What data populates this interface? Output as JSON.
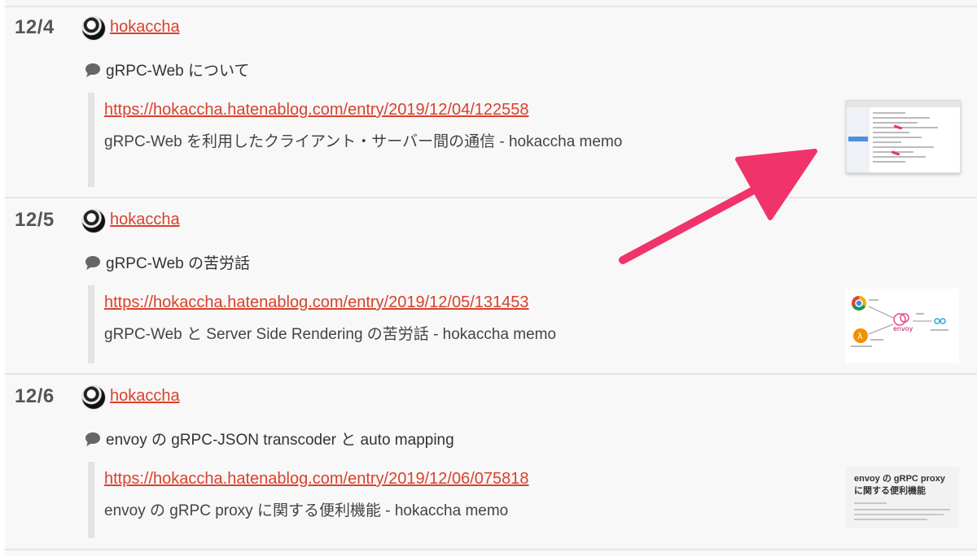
{
  "entries": [
    {
      "date": "12/4",
      "user": "hokaccha",
      "comment": "gRPC-Web について",
      "url": "https://hokaccha.hatenablog.com/entry/2019/12/04/122558",
      "title": "gRPC-Web を利用したクライアント・サーバー間の通信 - hokaccha memo"
    },
    {
      "date": "12/5",
      "user": "hokaccha",
      "comment": "gRPC-Web の苦労話",
      "url": "https://hokaccha.hatenablog.com/entry/2019/12/05/131453",
      "title": "gRPC-Web と Server Side Rendering の苦労話 - hokaccha memo",
      "thumb_labels": [
        "envoy"
      ]
    },
    {
      "date": "12/6",
      "user": "hokaccha",
      "comment": "envoy の gRPC-JSON transcoder と auto mapping",
      "url": "https://hokaccha.hatenablog.com/entry/2019/12/06/075818",
      "title": "envoy の gRPC proxy に関する便利機能 - hokaccha memo",
      "thumb_title": "envoy の gRPC proxy に関する便利機能"
    }
  ],
  "colors": {
    "link": "#d9412b",
    "arrow": "#f0336b"
  },
  "icons": {
    "comment": "speech-bubble-icon"
  }
}
